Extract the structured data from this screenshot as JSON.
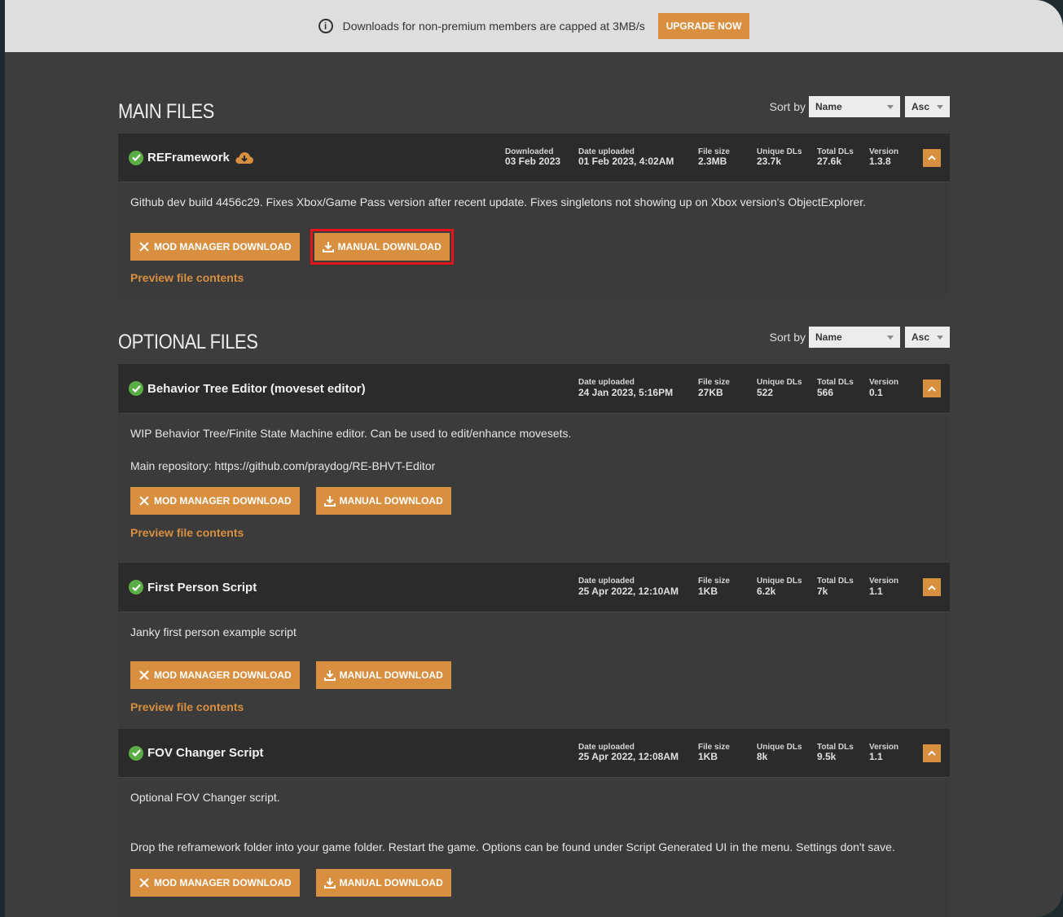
{
  "banner": {
    "message": "Downloads for non-premium members are capped at 3MB/s",
    "upgrade_label": "UPGRADE NOW"
  },
  "labels": {
    "sort_by": "Sort by",
    "sort_name": "Name",
    "sort_dir": "Asc",
    "mod_manager_download": "MOD MANAGER DOWNLOAD",
    "manual_download": "MANUAL DOWNLOAD",
    "preview": "Preview file contents",
    "k_downloaded": "Downloaded",
    "k_date_uploaded": "Date uploaded",
    "k_file_size": "File size",
    "k_unique_dls": "Unique DLs",
    "k_total_dls": "Total DLs",
    "k_version": "Version"
  },
  "main_files": {
    "title": "MAIN FILES",
    "files": [
      {
        "name": "REFramework",
        "downloaded": "03 Feb 2023",
        "date_uploaded": "01 Feb 2023, 4:02AM",
        "file_size": "2.3MB",
        "unique_dls": "23.7k",
        "total_dls": "27.6k",
        "version": "1.3.8",
        "description": "Github dev build 4456c29. Fixes Xbox/Game Pass version after recent update. Fixes singletons not showing up on Xbox version's ObjectExplorer."
      }
    ]
  },
  "optional_files": {
    "title": "OPTIONAL FILES",
    "files": [
      {
        "name": "Behavior Tree Editor (moveset editor)",
        "date_uploaded": "24 Jan 2023, 5:16PM",
        "file_size": "27KB",
        "unique_dls": "522",
        "total_dls": "566",
        "version": "0.1",
        "description": "WIP Behavior Tree/Finite State Machine editor. Can be used to edit/enhance movesets.",
        "description2": "Main repository: https://github.com/praydog/RE-BHVT-Editor"
      },
      {
        "name": "First Person Script",
        "date_uploaded": "25 Apr 2022, 12:10AM",
        "file_size": "1KB",
        "unique_dls": "6.2k",
        "total_dls": "7k",
        "version": "1.1",
        "description": "Janky first person example script"
      },
      {
        "name": "FOV Changer Script",
        "date_uploaded": "25 Apr 2022, 12:08AM",
        "file_size": "1KB",
        "unique_dls": "8k",
        "total_dls": "9.5k",
        "version": "1.1",
        "description": "Optional FOV Changer script.",
        "description2": "Drop the reframework folder into your game folder. Restart the game. Options can be found under Script Generated UI in the menu. Settings don't save."
      }
    ]
  },
  "colors": {
    "accent": "#d98f40",
    "highlight": "#e3141b",
    "check": "#5aac44"
  }
}
